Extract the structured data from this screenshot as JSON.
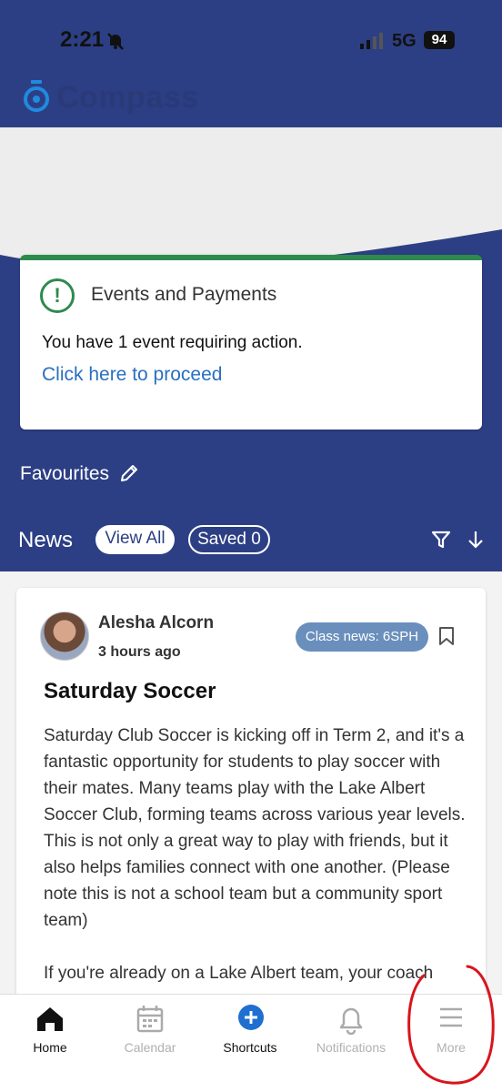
{
  "status_bar": {
    "time": "2:21",
    "network": "5G",
    "battery": "94"
  },
  "app": {
    "logo_text": "Compass"
  },
  "events_card": {
    "title": "Events and Payments",
    "message": "You have 1 event requiring action.",
    "link": "Click here to proceed"
  },
  "favourites": {
    "label": "Favourites"
  },
  "news": {
    "label": "News",
    "view_all": "View All",
    "saved": "Saved 0"
  },
  "post": {
    "author": "Alesha Alcorn",
    "time": "3 hours ago",
    "tag": "Class news: 6SPH",
    "title": "Saturday Soccer",
    "body": "Saturday Club Soccer is kicking off in Term 2, and it's a fantastic opportunity for students to play soccer with their mates. Many teams play with the Lake Albert Soccer Club, forming teams across various year levels. This is not only a great way to play with friends, but it also helps families connect with one another. (Please note this is not a school team but a community sport team)\n\nIf you're already on a Lake Albert team, your coach"
  },
  "nav": [
    {
      "label": "Home",
      "icon": "home-icon"
    },
    {
      "label": "Calendar",
      "icon": "calendar-icon"
    },
    {
      "label": "Shortcuts",
      "icon": "plus-circle-icon"
    },
    {
      "label": "Notifications",
      "icon": "bell-icon"
    },
    {
      "label": "More",
      "icon": "menu-icon"
    }
  ],
  "colors": {
    "brand_blue": "#2d3f84",
    "success_green": "#2e8a4e",
    "link_blue": "#2a6fc0",
    "tag_blue": "#6a8fbc",
    "annotation_red": "#d9141d"
  }
}
